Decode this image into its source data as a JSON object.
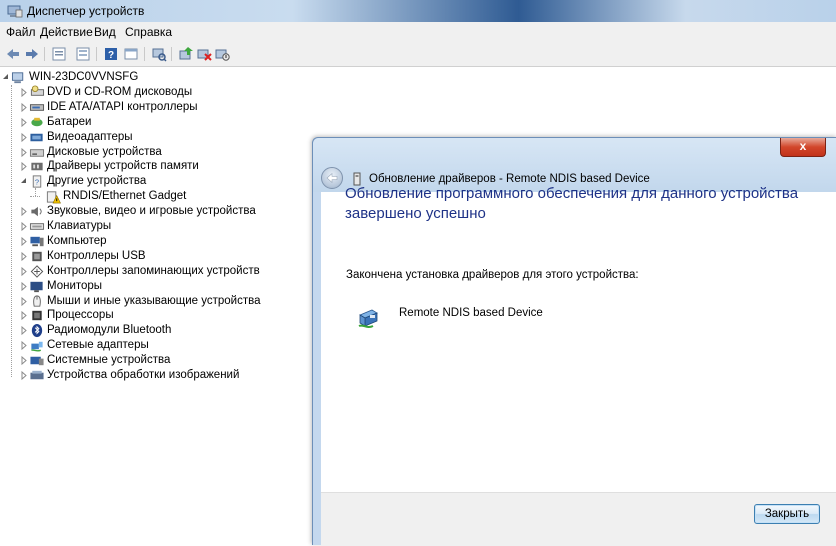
{
  "window": {
    "title": "Диспетчер устройств"
  },
  "menu": [
    "Файл",
    "Действие",
    "Вид",
    "Справка"
  ],
  "toolbar": [
    "back-icon",
    "forward-icon",
    "properties-view-icon",
    "list-view-icon",
    "help-icon",
    "console-icon",
    "scan-hardware-icon",
    "update-driver-icon",
    "uninstall-device-icon",
    "disable-device-icon"
  ],
  "tree": {
    "root": "WIN-23DC0VVNSFG",
    "items": [
      {
        "label": "DVD и CD-ROM дисководы",
        "icon": "dvd-drive-icon"
      },
      {
        "label": "IDE ATA/ATAPI контроллеры",
        "icon": "ide-controller-icon"
      },
      {
        "label": "Батареи",
        "icon": "battery-icon"
      },
      {
        "label": "Видеоадаптеры",
        "icon": "display-adapter-icon"
      },
      {
        "label": "Дисковые устройства",
        "icon": "disk-drive-icon"
      },
      {
        "label": "Драйверы устройств памяти",
        "icon": "memory-driver-icon"
      },
      {
        "label": "Другие устройства",
        "icon": "other-devices-icon",
        "expanded": true,
        "children": [
          {
            "label": "RNDIS/Ethernet Gadget",
            "icon": "unknown-device-warning-icon"
          }
        ]
      },
      {
        "label": "Звуковые, видео и игровые устройства",
        "icon": "sound-icon"
      },
      {
        "label": "Клавиатуры",
        "icon": "keyboard-icon"
      },
      {
        "label": "Компьютер",
        "icon": "computer-icon"
      },
      {
        "label": "Контроллеры USB",
        "icon": "usb-controller-icon"
      },
      {
        "label": "Контроллеры запоминающих устройств",
        "icon": "storage-controller-icon"
      },
      {
        "label": "Мониторы",
        "icon": "monitor-icon"
      },
      {
        "label": "Мыши и иные указывающие устройства",
        "icon": "mouse-icon"
      },
      {
        "label": "Процессоры",
        "icon": "processor-icon"
      },
      {
        "label": "Радиомодули Bluetooth",
        "icon": "bluetooth-icon"
      },
      {
        "label": "Сетевые адаптеры",
        "icon": "network-adapter-icon"
      },
      {
        "label": "Системные устройства",
        "icon": "system-device-icon"
      },
      {
        "label": "Устройства обработки изображений",
        "icon": "imaging-device-icon"
      }
    ]
  },
  "dialog": {
    "title": "Обновление драйверов - Remote NDIS based Device",
    "close_glyph": "x",
    "heading": "Обновление программного обеспечения для данного устройства завершено успешно",
    "message": "Закончена установка драйверов для этого устройства:",
    "device_name": "Remote NDIS based Device",
    "close_button_label": "Закрыть"
  },
  "colors": {
    "heading_blue": "#1e3287",
    "dialog_frame": "#c4d8ee",
    "close_red": "#c1321a"
  }
}
